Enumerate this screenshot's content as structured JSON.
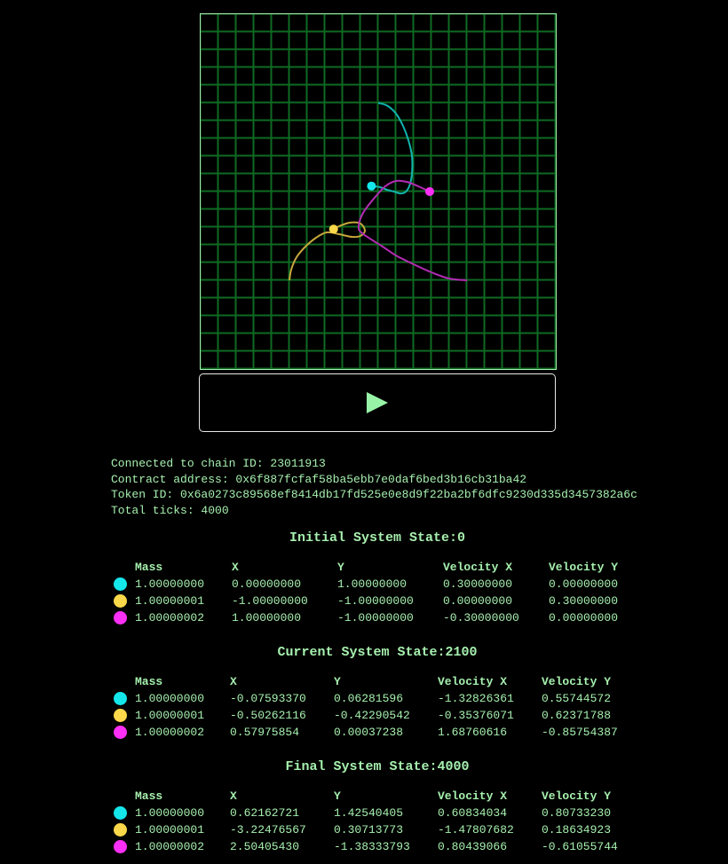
{
  "canvas": {
    "grid_color": "#0e6a22",
    "border_color": "#a6f0ae",
    "background": "#000000",
    "view_range": {
      "x": [
        -2,
        2
      ],
      "y": [
        -2,
        2
      ]
    },
    "bodies": [
      {
        "name": "cyan",
        "color": "#14e6ea",
        "trail_color": "#12b4b0",
        "position": [
          -0.0759337,
          0.06281596
        ],
        "trail": [
          [
            0.0,
            1.0
          ],
          [
            0.1,
            0.97
          ],
          [
            0.2,
            0.88
          ],
          [
            0.28,
            0.74
          ],
          [
            0.34,
            0.58
          ],
          [
            0.38,
            0.4
          ],
          [
            0.38,
            0.2
          ],
          [
            0.35,
            0.06
          ],
          [
            0.3,
            -0.01
          ],
          [
            0.24,
            -0.02
          ],
          [
            0.18,
            0.0
          ],
          [
            0.1,
            0.02
          ],
          [
            0.02,
            0.05
          ],
          [
            -0.076,
            0.063
          ]
        ]
      },
      {
        "name": "yellow",
        "color": "#fbd84a",
        "trail_color": "#c7a83c",
        "position": [
          -0.50262116,
          -0.42290542
        ],
        "trail": [
          [
            -1.0,
            -1.0
          ],
          [
            -0.98,
            -0.88
          ],
          [
            -0.92,
            -0.74
          ],
          [
            -0.82,
            -0.62
          ],
          [
            -0.7,
            -0.52
          ],
          [
            -0.58,
            -0.46
          ],
          [
            -0.44,
            -0.48
          ],
          [
            -0.3,
            -0.51
          ],
          [
            -0.2,
            -0.5
          ],
          [
            -0.15,
            -0.44
          ],
          [
            -0.2,
            -0.36
          ],
          [
            -0.32,
            -0.35
          ],
          [
            -0.44,
            -0.39
          ],
          [
            -0.503,
            -0.423
          ]
        ]
      },
      {
        "name": "magenta",
        "color": "#fb2ff5",
        "trail_color": "#b32cb4",
        "position": [
          0.57975854,
          0.00037238
        ],
        "trail": [
          [
            1.0,
            -1.0
          ],
          [
            0.8,
            -0.98
          ],
          [
            0.6,
            -0.91
          ],
          [
            0.4,
            -0.82
          ],
          [
            0.2,
            -0.72
          ],
          [
            0.05,
            -0.62
          ],
          [
            -0.18,
            -0.47
          ],
          [
            -0.22,
            -0.39
          ],
          [
            -0.17,
            -0.24
          ],
          [
            -0.05,
            -0.08
          ],
          [
            0.08,
            0.06
          ],
          [
            0.2,
            0.12
          ],
          [
            0.32,
            0.11
          ],
          [
            0.45,
            0.06
          ],
          [
            0.58,
            0.0
          ]
        ]
      }
    ]
  },
  "play_button": {
    "icon": "play-icon"
  },
  "info": {
    "chain_line": "Connected to chain ID: 23011913",
    "contract_line": "Contract address: 0x6f887fcfaf58ba5ebb7e0daf6bed3b16cb31ba42",
    "token_line": "Token ID: 0x6a0273c89568ef8414db17fd525e0e8d9f22ba2bf6dfc9230d335d3457382a6c",
    "ticks_line": "Total ticks: 4000"
  },
  "columns": [
    "Mass",
    "X",
    "Y",
    "Velocity X",
    "Velocity Y"
  ],
  "body_colors": [
    "#14e6ea",
    "#fbd84a",
    "#fb2ff5"
  ],
  "states": {
    "initial": {
      "title": "Initial System State:0",
      "rows": [
        [
          "1.00000000",
          "0.00000000",
          "1.00000000",
          "0.30000000",
          "0.00000000"
        ],
        [
          "1.00000001",
          "-1.00000000",
          "-1.00000000",
          "0.00000000",
          "0.30000000"
        ],
        [
          "1.00000002",
          "1.00000000",
          "-1.00000000",
          "-0.30000000",
          "0.00000000"
        ]
      ]
    },
    "current": {
      "title": "Current System State:2100",
      "rows": [
        [
          "1.00000000",
          "-0.07593370",
          "0.06281596",
          "-1.32826361",
          "0.55744572"
        ],
        [
          "1.00000001",
          "-0.50262116",
          "-0.42290542",
          "-0.35376071",
          "0.62371788"
        ],
        [
          "1.00000002",
          "0.57975854",
          "0.00037238",
          "1.68760616",
          "-0.85754387"
        ]
      ]
    },
    "final": {
      "title": "Final System State:4000",
      "rows": [
        [
          "1.00000000",
          "0.62162721",
          "1.42540405",
          "0.60834034",
          "0.80733230"
        ],
        [
          "1.00000001",
          "-3.22476567",
          "0.30713773",
          "-1.47807682",
          "0.18634923"
        ],
        [
          "1.00000002",
          "2.50405430",
          "-1.38333793",
          "0.80439066",
          "-0.61055744"
        ]
      ]
    }
  }
}
